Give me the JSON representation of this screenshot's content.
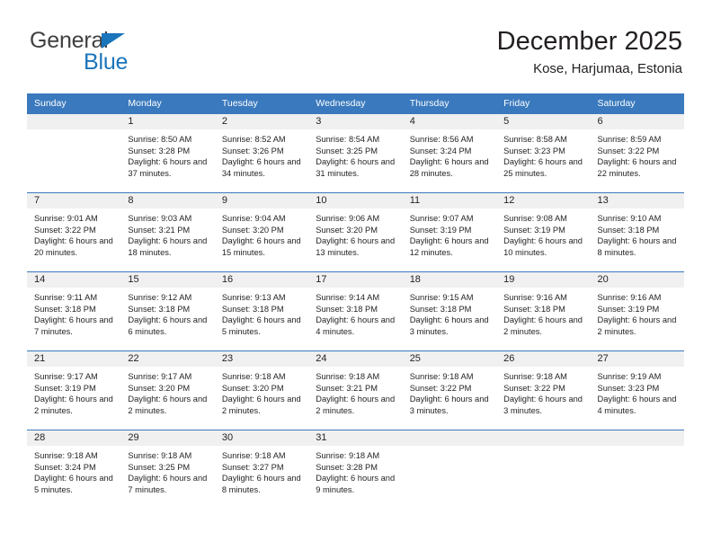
{
  "brand": {
    "name_part1": "General",
    "name_part2": "Blue",
    "triangle_color": "#1b75bb",
    "text_color": "#404041"
  },
  "header": {
    "title": "December 2025",
    "subtitle": "Kose, Harjumaa, Estonia",
    "accent_color": "#3a79bd"
  },
  "calendar": {
    "weekday_headers": [
      "Sunday",
      "Monday",
      "Tuesday",
      "Wednesday",
      "Thursday",
      "Friday",
      "Saturday"
    ],
    "weeks": [
      [
        {
          "day": "",
          "empty": true
        },
        {
          "day": "1",
          "sunrise": "Sunrise: 8:50 AM",
          "sunset": "Sunset: 3:28 PM",
          "daylight": "Daylight: 6 hours and 37 minutes."
        },
        {
          "day": "2",
          "sunrise": "Sunrise: 8:52 AM",
          "sunset": "Sunset: 3:26 PM",
          "daylight": "Daylight: 6 hours and 34 minutes."
        },
        {
          "day": "3",
          "sunrise": "Sunrise: 8:54 AM",
          "sunset": "Sunset: 3:25 PM",
          "daylight": "Daylight: 6 hours and 31 minutes."
        },
        {
          "day": "4",
          "sunrise": "Sunrise: 8:56 AM",
          "sunset": "Sunset: 3:24 PM",
          "daylight": "Daylight: 6 hours and 28 minutes."
        },
        {
          "day": "5",
          "sunrise": "Sunrise: 8:58 AM",
          "sunset": "Sunset: 3:23 PM",
          "daylight": "Daylight: 6 hours and 25 minutes."
        },
        {
          "day": "6",
          "sunrise": "Sunrise: 8:59 AM",
          "sunset": "Sunset: 3:22 PM",
          "daylight": "Daylight: 6 hours and 22 minutes."
        }
      ],
      [
        {
          "day": "7",
          "sunrise": "Sunrise: 9:01 AM",
          "sunset": "Sunset: 3:22 PM",
          "daylight": "Daylight: 6 hours and 20 minutes."
        },
        {
          "day": "8",
          "sunrise": "Sunrise: 9:03 AM",
          "sunset": "Sunset: 3:21 PM",
          "daylight": "Daylight: 6 hours and 18 minutes."
        },
        {
          "day": "9",
          "sunrise": "Sunrise: 9:04 AM",
          "sunset": "Sunset: 3:20 PM",
          "daylight": "Daylight: 6 hours and 15 minutes."
        },
        {
          "day": "10",
          "sunrise": "Sunrise: 9:06 AM",
          "sunset": "Sunset: 3:20 PM",
          "daylight": "Daylight: 6 hours and 13 minutes."
        },
        {
          "day": "11",
          "sunrise": "Sunrise: 9:07 AM",
          "sunset": "Sunset: 3:19 PM",
          "daylight": "Daylight: 6 hours and 12 minutes."
        },
        {
          "day": "12",
          "sunrise": "Sunrise: 9:08 AM",
          "sunset": "Sunset: 3:19 PM",
          "daylight": "Daylight: 6 hours and 10 minutes."
        },
        {
          "day": "13",
          "sunrise": "Sunrise: 9:10 AM",
          "sunset": "Sunset: 3:18 PM",
          "daylight": "Daylight: 6 hours and 8 minutes."
        }
      ],
      [
        {
          "day": "14",
          "sunrise": "Sunrise: 9:11 AM",
          "sunset": "Sunset: 3:18 PM",
          "daylight": "Daylight: 6 hours and 7 minutes."
        },
        {
          "day": "15",
          "sunrise": "Sunrise: 9:12 AM",
          "sunset": "Sunset: 3:18 PM",
          "daylight": "Daylight: 6 hours and 6 minutes."
        },
        {
          "day": "16",
          "sunrise": "Sunrise: 9:13 AM",
          "sunset": "Sunset: 3:18 PM",
          "daylight": "Daylight: 6 hours and 5 minutes."
        },
        {
          "day": "17",
          "sunrise": "Sunrise: 9:14 AM",
          "sunset": "Sunset: 3:18 PM",
          "daylight": "Daylight: 6 hours and 4 minutes."
        },
        {
          "day": "18",
          "sunrise": "Sunrise: 9:15 AM",
          "sunset": "Sunset: 3:18 PM",
          "daylight": "Daylight: 6 hours and 3 minutes."
        },
        {
          "day": "19",
          "sunrise": "Sunrise: 9:16 AM",
          "sunset": "Sunset: 3:18 PM",
          "daylight": "Daylight: 6 hours and 2 minutes."
        },
        {
          "day": "20",
          "sunrise": "Sunrise: 9:16 AM",
          "sunset": "Sunset: 3:19 PM",
          "daylight": "Daylight: 6 hours and 2 minutes."
        }
      ],
      [
        {
          "day": "21",
          "sunrise": "Sunrise: 9:17 AM",
          "sunset": "Sunset: 3:19 PM",
          "daylight": "Daylight: 6 hours and 2 minutes."
        },
        {
          "day": "22",
          "sunrise": "Sunrise: 9:17 AM",
          "sunset": "Sunset: 3:20 PM",
          "daylight": "Daylight: 6 hours and 2 minutes."
        },
        {
          "day": "23",
          "sunrise": "Sunrise: 9:18 AM",
          "sunset": "Sunset: 3:20 PM",
          "daylight": "Daylight: 6 hours and 2 minutes."
        },
        {
          "day": "24",
          "sunrise": "Sunrise: 9:18 AM",
          "sunset": "Sunset: 3:21 PM",
          "daylight": "Daylight: 6 hours and 2 minutes."
        },
        {
          "day": "25",
          "sunrise": "Sunrise: 9:18 AM",
          "sunset": "Sunset: 3:22 PM",
          "daylight": "Daylight: 6 hours and 3 minutes."
        },
        {
          "day": "26",
          "sunrise": "Sunrise: 9:18 AM",
          "sunset": "Sunset: 3:22 PM",
          "daylight": "Daylight: 6 hours and 3 minutes."
        },
        {
          "day": "27",
          "sunrise": "Sunrise: 9:19 AM",
          "sunset": "Sunset: 3:23 PM",
          "daylight": "Daylight: 6 hours and 4 minutes."
        }
      ],
      [
        {
          "day": "28",
          "sunrise": "Sunrise: 9:18 AM",
          "sunset": "Sunset: 3:24 PM",
          "daylight": "Daylight: 6 hours and 5 minutes."
        },
        {
          "day": "29",
          "sunrise": "Sunrise: 9:18 AM",
          "sunset": "Sunset: 3:25 PM",
          "daylight": "Daylight: 6 hours and 7 minutes."
        },
        {
          "day": "30",
          "sunrise": "Sunrise: 9:18 AM",
          "sunset": "Sunset: 3:27 PM",
          "daylight": "Daylight: 6 hours and 8 minutes."
        },
        {
          "day": "31",
          "sunrise": "Sunrise: 9:18 AM",
          "sunset": "Sunset: 3:28 PM",
          "daylight": "Daylight: 6 hours and 9 minutes."
        },
        {
          "day": "",
          "empty": true
        },
        {
          "day": "",
          "empty": true
        },
        {
          "day": "",
          "empty": true
        }
      ]
    ]
  }
}
